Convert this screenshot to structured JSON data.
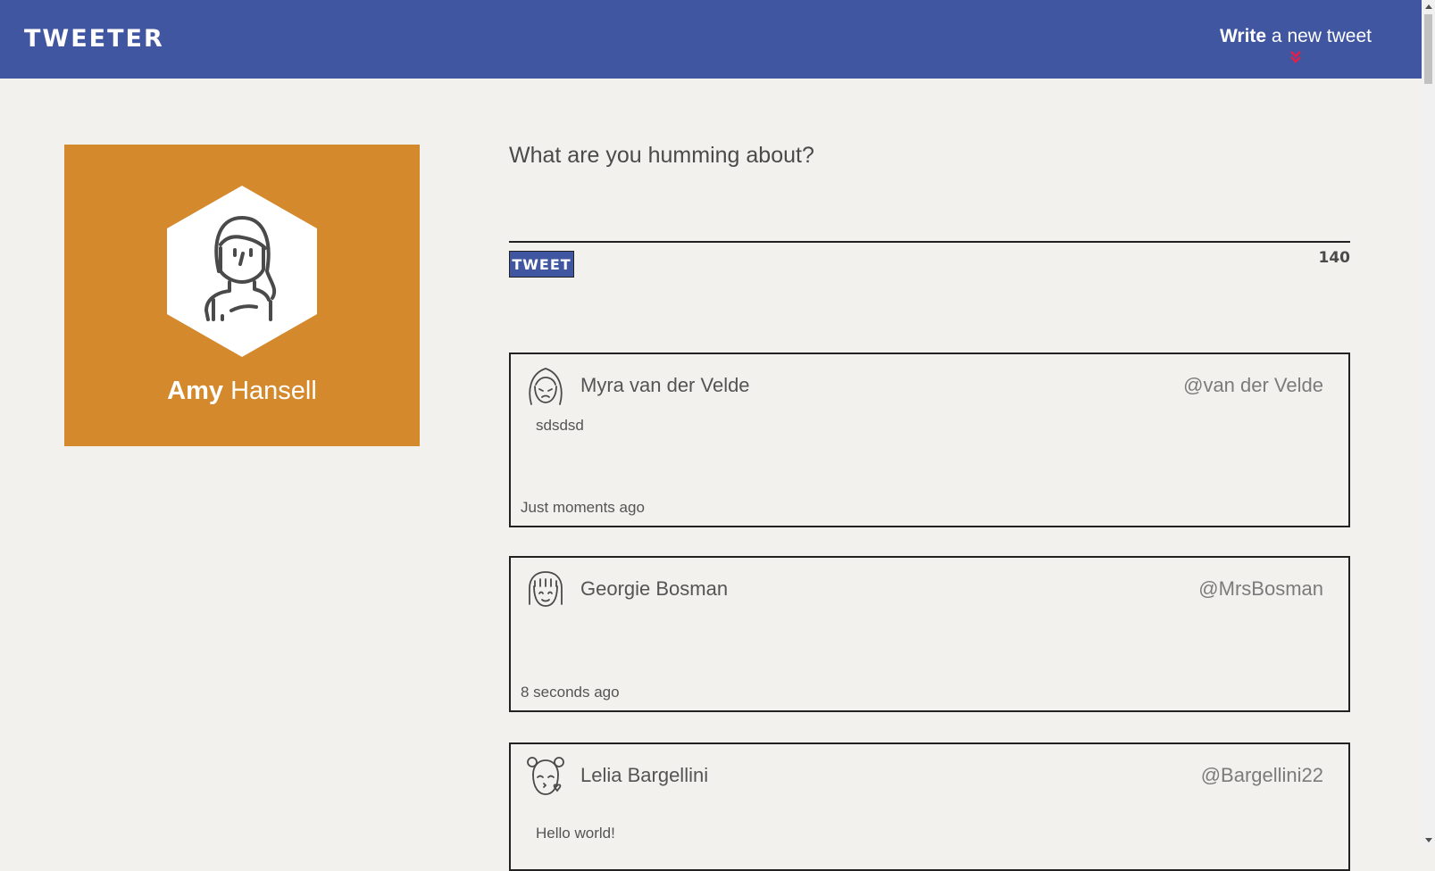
{
  "nav": {
    "brand": "TWEETER",
    "compose_bold": "Write",
    "compose_rest": " a new tweet",
    "toggle_icon": "double-chevron-down-icon",
    "toggle_color": "#e0204a",
    "background": "#4056a1"
  },
  "profile": {
    "first_name": "Amy",
    "last_name": " Hansell",
    "avatar_icon": "woman-avatar-icon",
    "background": "#d4892c"
  },
  "composer": {
    "prompt": "What are you humming about?",
    "input_value": "",
    "button_label": "TWEET",
    "counter": "140"
  },
  "tweets": [
    {
      "name": "Myra van der Velde",
      "handle": "@van der Velde",
      "body": "sdsdsd",
      "time": "Just moments ago",
      "avatar_icon": "girl-sad-avatar-icon"
    },
    {
      "name": "Georgie Bosman",
      "handle": "@MrsBosman",
      "body": "",
      "time": "8 seconds ago",
      "avatar_icon": "girl-bangs-avatar-icon"
    },
    {
      "name": "Lelia Bargellini",
      "handle": "@Bargellini22",
      "body": "Hello world!",
      "time": "",
      "avatar_icon": "girl-kiss-avatar-icon"
    }
  ]
}
